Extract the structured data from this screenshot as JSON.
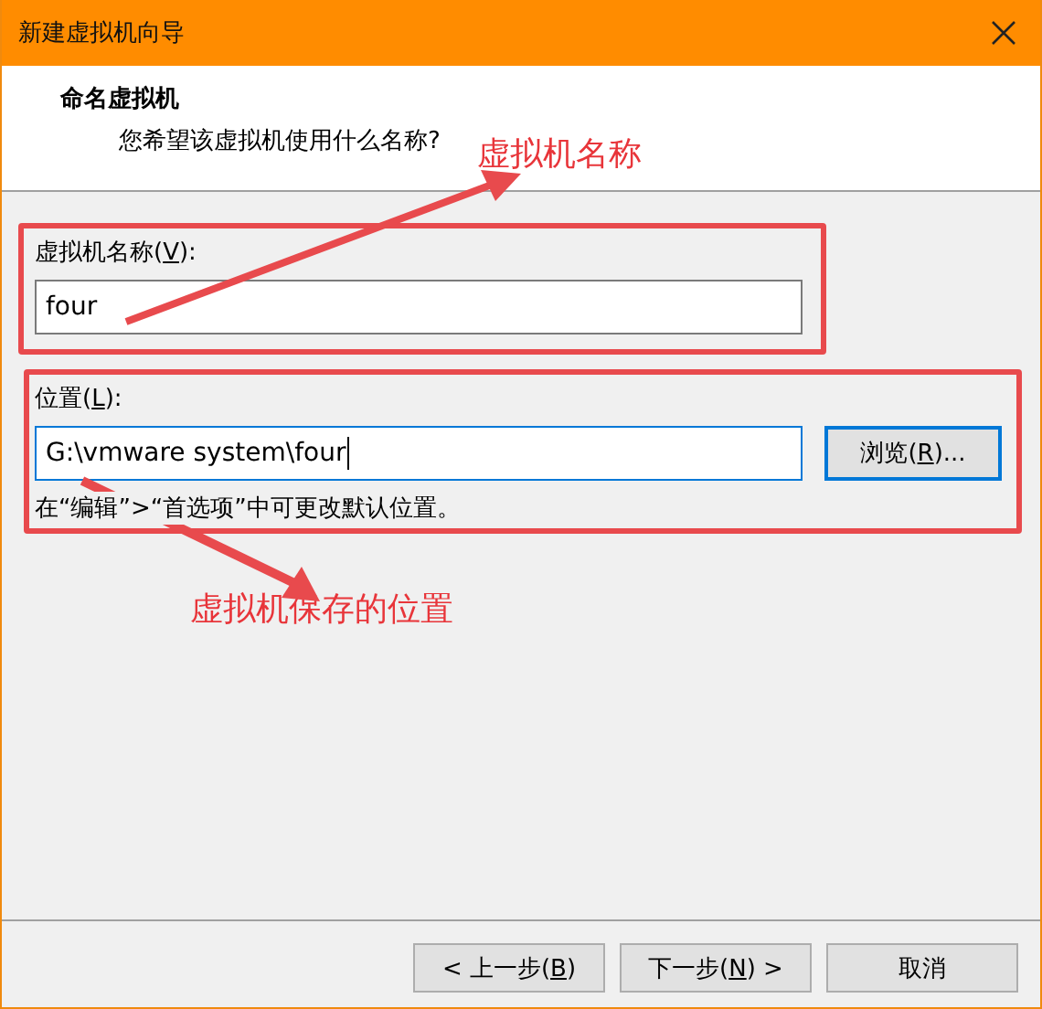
{
  "window": {
    "title": "新建虚拟机向导"
  },
  "header": {
    "title": "命名虚拟机",
    "subtitle": "您希望该虚拟机使用什么名称?"
  },
  "fields": [
    {
      "label": "虚拟机名称(",
      "access_key": "V",
      "label_end": "):",
      "value": "four",
      "focused": false
    },
    {
      "label": "位置(",
      "access_key": "L",
      "label_end": "):",
      "value": "G:\\vmware system\\four",
      "focused": true,
      "button": {
        "label": "浏览(",
        "access_key": "R",
        "label_end": ")..."
      },
      "hint": "在“编辑”>“首选项”中可更改默认位置。"
    }
  ],
  "annotations": [
    {
      "text": "虚拟机名称"
    },
    {
      "text": "虚拟机保存的位置"
    }
  ],
  "buttons": [
    {
      "label": "< 上一步(",
      "access_key": "B",
      "label_end": ")"
    },
    {
      "label": "下一步(",
      "access_key": "N",
      "label_end": ") >"
    },
    {
      "label": "取消"
    }
  ]
}
